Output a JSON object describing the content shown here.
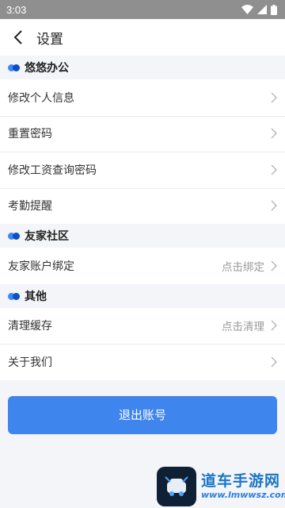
{
  "status_bar": {
    "time": "3:03"
  },
  "header": {
    "title": "设置"
  },
  "sections": [
    {
      "title": "悠悠办公",
      "items": [
        {
          "label": "修改个人信息",
          "hint": ""
        },
        {
          "label": "重置密码",
          "hint": ""
        },
        {
          "label": "修改工资查询密码",
          "hint": ""
        },
        {
          "label": "考勤提醒",
          "hint": ""
        }
      ]
    },
    {
      "title": "友家社区",
      "items": [
        {
          "label": "友家账户绑定",
          "hint": "点击绑定"
        }
      ]
    },
    {
      "title": "其他",
      "items": [
        {
          "label": "清理缓存",
          "hint": "点击清理"
        },
        {
          "label": "关于我们",
          "hint": ""
        }
      ]
    }
  ],
  "logout_label": "退出账号",
  "watermark": {
    "title": "道车手游网",
    "url": "www.lmwwsz.com"
  },
  "colors": {
    "accent": "#3f85ee",
    "dot_light": "#3d89f3",
    "dot_dark": "#0d4fc4",
    "status_bar": "#8f8f8f",
    "background": "#f4f5f9"
  }
}
